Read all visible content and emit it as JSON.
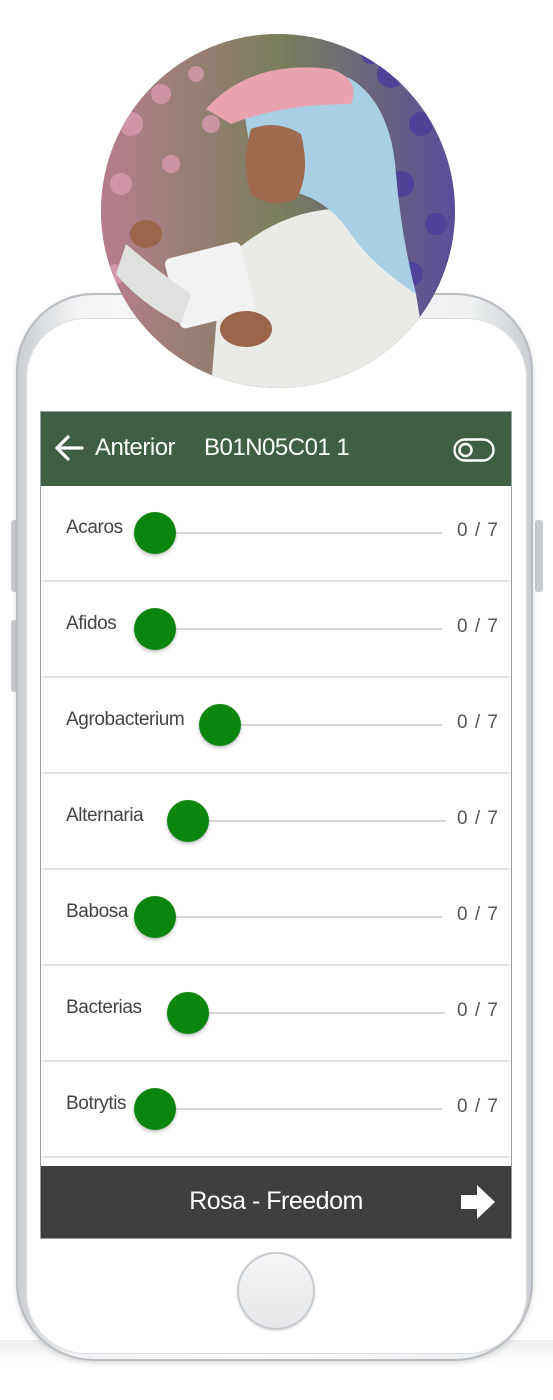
{
  "header": {
    "back_label": "Anterior",
    "code": "B01N05C01 1",
    "back_icon": "arrow-left-icon",
    "toggle_icon": "toggle-icon"
  },
  "pests": [
    {
      "name": "Acaros",
      "value": "0 / 7"
    },
    {
      "name": "Afidos",
      "value": "0 / 7"
    },
    {
      "name": "Agrobacterium",
      "value": "0 / 7"
    },
    {
      "name": "Alternaria",
      "value": "0 / 7"
    },
    {
      "name": "Babosa",
      "value": "0 / 7"
    },
    {
      "name": "Bacterias",
      "value": "0 / 7"
    },
    {
      "name": "Botrytis",
      "value": "0 / 7"
    }
  ],
  "footer": {
    "label": "Rosa - Freedom",
    "next_icon": "arrow-right-icon"
  },
  "colors": {
    "header_bg": "#3f5e44",
    "slider_thumb": "#0a850d",
    "footer_bg": "#3f3f3f"
  },
  "avatar": {
    "description_icon": "user-photo"
  }
}
